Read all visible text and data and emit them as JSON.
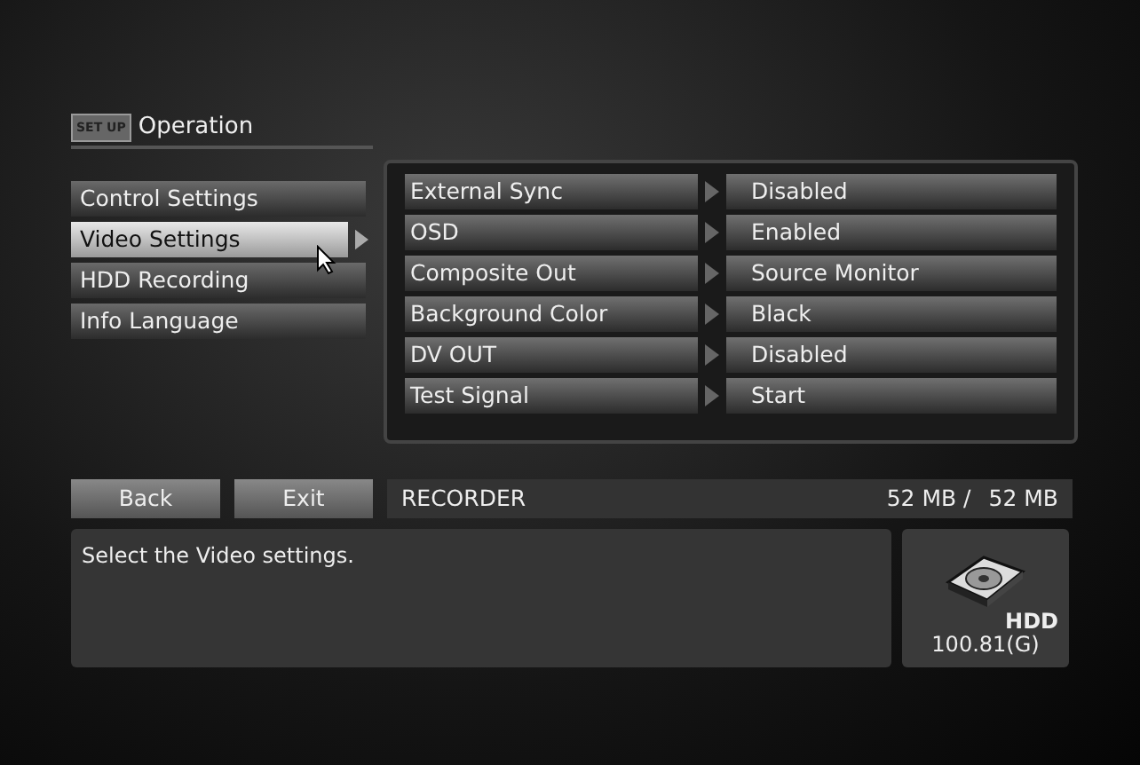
{
  "header": {
    "badge": "SET UP",
    "title": "Operation"
  },
  "menu": [
    {
      "label": "Control Settings",
      "selected": false
    },
    {
      "label": "Video Settings",
      "selected": true
    },
    {
      "label": "HDD Recording",
      "selected": false
    },
    {
      "label": "Info Language",
      "selected": false
    }
  ],
  "settings": [
    {
      "label": "External Sync",
      "value": "Disabled"
    },
    {
      "label": "OSD",
      "value": "Enabled"
    },
    {
      "label": "Composite Out",
      "value": "Source Monitor"
    },
    {
      "label": "Background Color",
      "value": "Black"
    },
    {
      "label": "DV OUT",
      "value": "Disabled"
    },
    {
      "label": "Test Signal",
      "value": "Start"
    }
  ],
  "buttons": [
    "Back",
    "Exit"
  ],
  "status": {
    "name": "RECORDER",
    "used": "52 MB /",
    "total": "52 MB"
  },
  "message": "Select the Video settings.",
  "hdd": {
    "label": "HDD",
    "capacity": "100.81(G)"
  }
}
